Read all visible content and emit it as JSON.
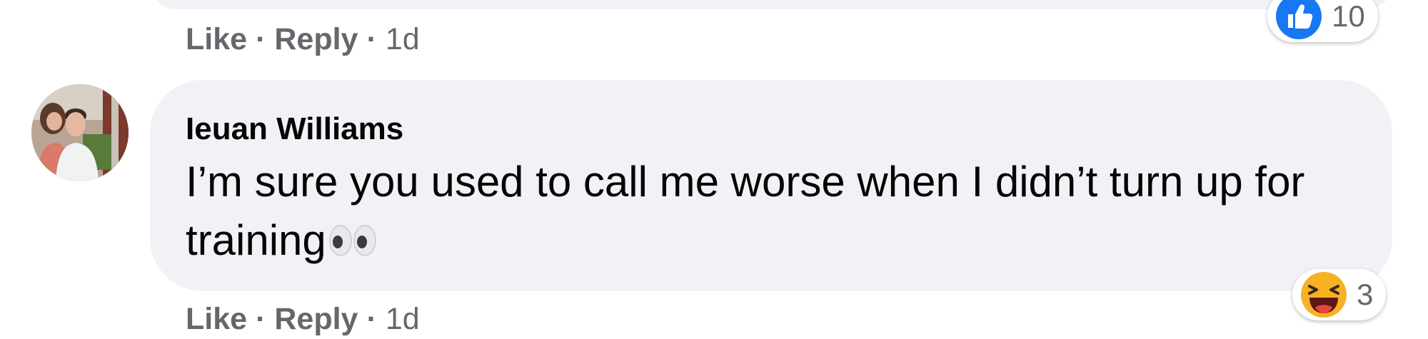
{
  "previous_comment": {
    "actions": {
      "like_label": "Like",
      "separator": "·",
      "reply_label": "Reply",
      "timestamp": "1d"
    },
    "reaction": {
      "icon": "like-thumb-icon",
      "count": "10",
      "color": "#1877f2"
    }
  },
  "comment": {
    "author": "Ieuan Williams",
    "text": "I’m sure you used to call me worse when I didn’t turn up for training",
    "emoji": "eyes-icon",
    "actions": {
      "like_label": "Like",
      "separator": "·",
      "reply_label": "Reply",
      "timestamp": "1d"
    },
    "reaction": {
      "icon": "laughing-face-icon",
      "count": "3",
      "color": "#f7b125"
    }
  },
  "colors": {
    "bubble": "#f0f2f5",
    "secondary_text": "#65676b",
    "primary_text": "#050505"
  }
}
